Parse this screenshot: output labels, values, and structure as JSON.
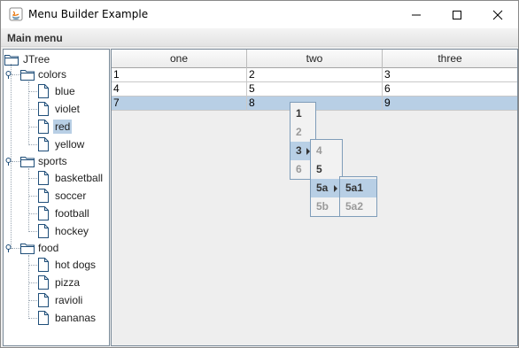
{
  "window": {
    "title": "Menu Builder Example"
  },
  "menubar": {
    "main_menu": "Main menu"
  },
  "tree": {
    "root": "JTree",
    "groups": [
      {
        "label": "colors",
        "items": [
          "blue",
          "violet",
          "red",
          "yellow"
        ]
      },
      {
        "label": "sports",
        "items": [
          "basketball",
          "soccer",
          "football",
          "hockey"
        ]
      },
      {
        "label": "food",
        "items": [
          "hot dogs",
          "pizza",
          "ravioli",
          "bananas"
        ]
      }
    ],
    "selected": "red"
  },
  "table": {
    "headers": [
      "one",
      "two",
      "three"
    ],
    "rows": [
      [
        "1",
        "2",
        "3"
      ],
      [
        "4",
        "5",
        "6"
      ],
      [
        "7",
        "8",
        "9"
      ]
    ],
    "selected_row": 3
  },
  "popup": {
    "level1": [
      "1",
      "2",
      "3",
      "6"
    ],
    "level2": [
      "4",
      "5",
      "5a",
      "5b"
    ],
    "level3": [
      "5a1",
      "5a2"
    ]
  },
  "colors": {
    "selection": "#b8cfe5",
    "border": "#7f9db9"
  }
}
